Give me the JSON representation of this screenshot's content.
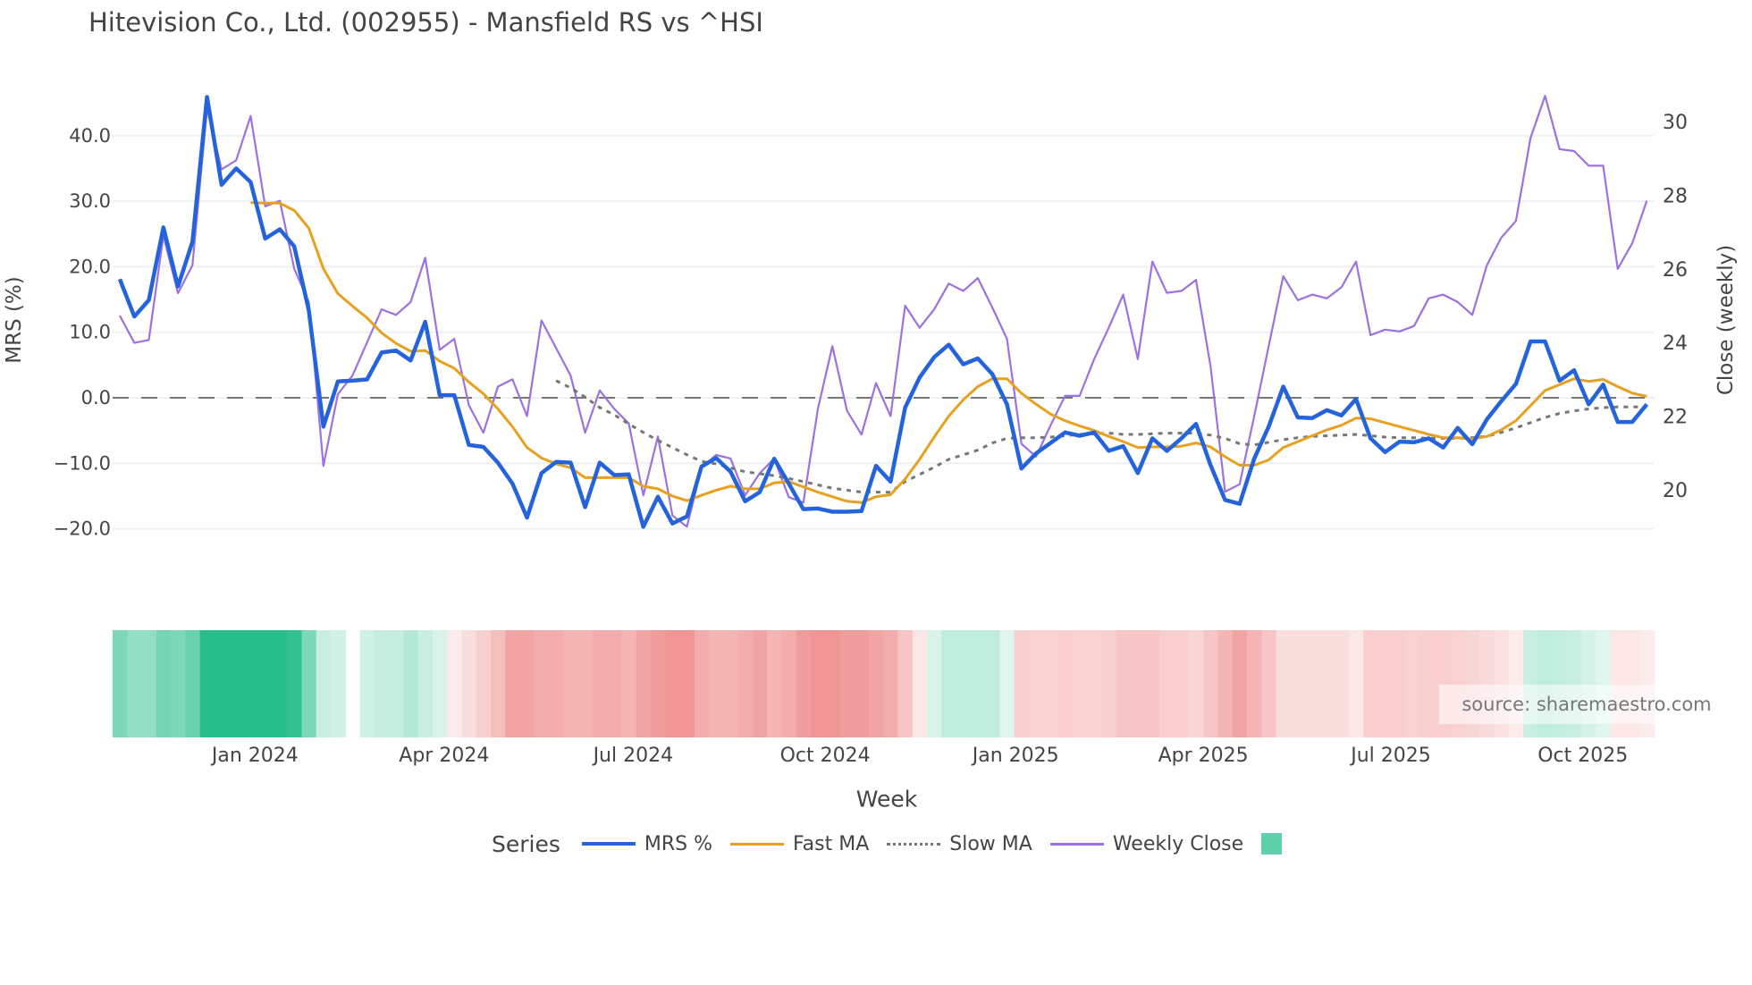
{
  "title": "Hitevision Co., Ltd. (002955) - Mansfield RS vs ^HSI",
  "source": "source: sharemaestro.com",
  "legend": {
    "title": "Series",
    "items": [
      "MRS %",
      "Fast MA",
      "Slow MA",
      "Weekly Close"
    ]
  },
  "colors": {
    "mrs": "#2563dc",
    "fast_ma": "#e8a020",
    "slow_ma": "#777777",
    "close": "#9b72e0",
    "heat_pos": "#27be8c",
    "heat_neg": "#e85a5a",
    "grid": "#eef0f5",
    "zero": "#777777",
    "legend_box": "#5fd1aa"
  },
  "chart_data": {
    "type": "line",
    "title": "Hitevision Co., Ltd. (002955) - Mansfield RS vs ^HSI",
    "xlabel": "Week",
    "ylabel": "MRS (%)",
    "y2label": "Close (weekly)",
    "ylim": [
      -21,
      47
    ],
    "y2lim": [
      18.8,
      31.3
    ],
    "yticks": [
      "40.0",
      "30.0",
      "20.0",
      "10.0",
      "0.0",
      "−10.0",
      "−20.0"
    ],
    "ytick_values": [
      40,
      30,
      20,
      10,
      0,
      -10,
      -20
    ],
    "y2ticks": [
      "30",
      "28",
      "26",
      "24",
      "22",
      "20"
    ],
    "y2tick_values": [
      30,
      28,
      26,
      24,
      22,
      20
    ],
    "xticks": [
      "Jan 2024",
      "Apr 2024",
      "Jul 2024",
      "Oct 2024",
      "Jan 2025",
      "Apr 2025",
      "Jul 2025",
      "Oct 2025"
    ],
    "xtick_week_index": [
      9.3,
      22.3,
      35.3,
      48.5,
      61.6,
      74.5,
      87.4,
      100.6
    ],
    "grid": true,
    "legend_position": "bottom",
    "series": [
      {
        "name": "MRS %",
        "values": [
          18.1,
          12.4,
          14.9,
          26.0,
          17.0,
          23.8,
          45.9,
          32.5,
          35.0,
          32.9,
          24.3,
          25.7,
          23.1,
          13.3,
          -4.4,
          2.5,
          2.6,
          2.8,
          6.9,
          7.2,
          5.7,
          11.6,
          0.4,
          0.4,
          -7.2,
          -7.5,
          -9.9,
          -13.1,
          -18.3,
          -11.5,
          -9.8,
          -9.9,
          -16.7,
          -9.9,
          -11.8,
          -11.7,
          -19.7,
          -15.1,
          -19.2,
          -18.1,
          -10.5,
          -9.2,
          -11.3,
          -15.8,
          -14.4,
          -9.3,
          -13.1,
          -17.0,
          -16.9,
          -17.4,
          -17.4,
          -17.3,
          -10.4,
          -12.8,
          -1.5,
          3.1,
          6.2,
          8.1,
          5.1,
          6.0,
          3.6,
          -1.0,
          -10.8,
          -8.5,
          -6.9,
          -5.3,
          -5.8,
          -5.3,
          -8.1,
          -7.4,
          -11.5,
          -6.2,
          -8.1,
          -6.2,
          -4.0,
          -10.3,
          -15.6,
          -16.2,
          -9.3,
          -4.4,
          1.7,
          -3.0,
          -3.1,
          -1.9,
          -2.7,
          -0.2,
          -6.2,
          -8.3,
          -6.7,
          -6.8,
          -6.2,
          -7.6,
          -4.6,
          -7.1,
          -3.3,
          -0.5,
          2.1,
          8.6,
          8.6,
          2.6,
          4.2,
          -1.0,
          2.0,
          -3.7,
          -3.7,
          -1.0
        ]
      },
      {
        "name": "Fast MA",
        "values": [
          null,
          null,
          null,
          null,
          null,
          null,
          null,
          null,
          null,
          29.8,
          29.7,
          29.7,
          28.6,
          25.9,
          19.7,
          15.9,
          14.0,
          12.2,
          9.9,
          8.3,
          7.1,
          7.2,
          5.6,
          4.5,
          2.4,
          0.6,
          -1.7,
          -4.4,
          -7.6,
          -9.2,
          -10.1,
          -10.7,
          -12.2,
          -12.2,
          -12.2,
          -12.2,
          -13.5,
          -13.9,
          -15.0,
          -15.7,
          -14.9,
          -14.1,
          -13.5,
          -13.9,
          -13.9,
          -13.0,
          -12.8,
          -13.6,
          -14.4,
          -15.1,
          -15.8,
          -16.0,
          -15.1,
          -14.8,
          -12.4,
          -9.4,
          -6.0,
          -2.8,
          -0.3,
          1.7,
          2.9,
          2.9,
          0.7,
          -1.0,
          -2.5,
          -3.5,
          -4.3,
          -5.0,
          -5.9,
          -6.7,
          -7.6,
          -7.5,
          -7.5,
          -7.4,
          -6.9,
          -7.5,
          -9.0,
          -10.3,
          -10.3,
          -9.5,
          -7.6,
          -6.7,
          -5.8,
          -4.9,
          -4.2,
          -3.1,
          -3.2,
          -3.8,
          -4.4,
          -5.0,
          -5.6,
          -6.1,
          -6.1,
          -6.3,
          -5.9,
          -4.9,
          -3.5,
          -1.2,
          1.1,
          2.0,
          2.9,
          2.5,
          2.8,
          1.7,
          0.7,
          0.2
        ]
      },
      {
        "name": "Slow MA",
        "values": [
          null,
          null,
          null,
          null,
          null,
          null,
          null,
          null,
          null,
          null,
          null,
          null,
          null,
          null,
          null,
          null,
          null,
          null,
          null,
          null,
          null,
          null,
          null,
          null,
          null,
          null,
          null,
          null,
          null,
          null,
          2.6,
          1.5,
          0.1,
          -1.5,
          -2.6,
          -4.0,
          -5.3,
          -6.5,
          -7.6,
          -8.7,
          -9.7,
          -10.1,
          -10.7,
          -11.3,
          -11.6,
          -11.9,
          -12.3,
          -12.8,
          -13.3,
          -13.8,
          -14.1,
          -14.4,
          -14.4,
          -14.4,
          -12.8,
          -11.7,
          -10.6,
          -9.4,
          -8.7,
          -8.0,
          -6.9,
          -6.2,
          -6.1,
          -6.1,
          -6.0,
          -5.8,
          -5.6,
          -5.5,
          -5.4,
          -5.6,
          -5.6,
          -5.5,
          -5.4,
          -5.4,
          -5.4,
          -5.7,
          -6.2,
          -7.0,
          -7.2,
          -6.8,
          -6.4,
          -6.1,
          -5.9,
          -5.8,
          -5.7,
          -5.6,
          -5.8,
          -6.0,
          -6.1,
          -6.1,
          -6.2,
          -6.2,
          -6.2,
          -6.1,
          -5.9,
          -5.3,
          -4.6,
          -3.8,
          -3.0,
          -2.4,
          -2.0,
          -1.7,
          -1.5,
          -1.4,
          -1.4,
          -1.4
        ]
      },
      {
        "name": "Weekly Close",
        "axis": "right",
        "values": [
          24.73,
          23.99,
          24.07,
          26.9,
          25.34,
          26.1,
          30.35,
          28.7,
          28.95,
          30.15,
          27.7,
          27.85,
          26.0,
          25.1,
          20.65,
          22.6,
          23.1,
          24.0,
          24.9,
          24.75,
          25.1,
          26.3,
          23.8,
          24.1,
          22.3,
          21.55,
          22.8,
          23.0,
          22.0,
          24.6,
          23.85,
          23.1,
          21.55,
          22.7,
          22.2,
          21.8,
          19.85,
          21.45,
          19.3,
          19.0,
          20.6,
          20.95,
          20.85,
          19.85,
          20.45,
          20.85,
          19.8,
          19.65,
          22.2,
          23.9,
          22.15,
          21.5,
          22.9,
          22.0,
          25.0,
          24.4,
          24.9,
          25.6,
          25.4,
          25.75,
          24.95,
          24.1,
          21.25,
          20.9,
          21.75,
          22.55,
          22.55,
          23.55,
          24.4,
          25.3,
          23.55,
          26.2,
          25.35,
          25.4,
          25.7,
          23.35,
          19.95,
          20.15,
          22.0,
          23.9,
          25.8,
          25.15,
          25.3,
          25.2,
          25.5,
          26.2,
          24.2,
          24.35,
          24.3,
          24.45,
          25.2,
          25.3,
          25.1,
          24.75,
          26.1,
          26.85,
          27.3,
          29.55,
          30.7,
          29.25,
          29.2,
          28.8,
          28.8,
          26.0,
          26.7,
          27.85
        ]
      }
    ],
    "heatmap": [
      0.6,
      0.5,
      0.5,
      0.65,
      0.6,
      0.7,
      1,
      1,
      1,
      1,
      1,
      1,
      0.95,
      0.6,
      0.25,
      0.22,
      null,
      0.22,
      0.27,
      0.27,
      0.35,
      0.25,
      0.18,
      -0.12,
      -0.2,
      -0.3,
      -0.4,
      -0.55,
      -0.55,
      -0.5,
      -0.5,
      -0.45,
      -0.45,
      -0.5,
      -0.5,
      -0.45,
      -0.55,
      -0.6,
      -0.65,
      -0.65,
      -0.5,
      -0.45,
      -0.45,
      -0.5,
      -0.55,
      -0.45,
      -0.5,
      -0.6,
      -0.65,
      -0.65,
      -0.6,
      -0.6,
      -0.55,
      -0.5,
      -0.35,
      -0.15,
      0.18,
      0.3,
      0.3,
      0.3,
      0.3,
      0.15,
      -0.3,
      -0.28,
      -0.28,
      -0.3,
      -0.28,
      -0.28,
      -0.3,
      -0.35,
      -0.35,
      -0.35,
      -0.3,
      -0.3,
      -0.25,
      -0.35,
      -0.45,
      -0.55,
      -0.45,
      -0.35,
      -0.2,
      -0.2,
      -0.2,
      -0.2,
      -0.2,
      -0.15,
      -0.3,
      -0.3,
      -0.3,
      -0.28,
      -0.3,
      -0.3,
      -0.28,
      -0.25,
      -0.22,
      -0.18,
      -0.12,
      0.25,
      0.3,
      0.28,
      0.25,
      0.2,
      0.15,
      -0.15,
      -0.15,
      -0.12
    ]
  }
}
